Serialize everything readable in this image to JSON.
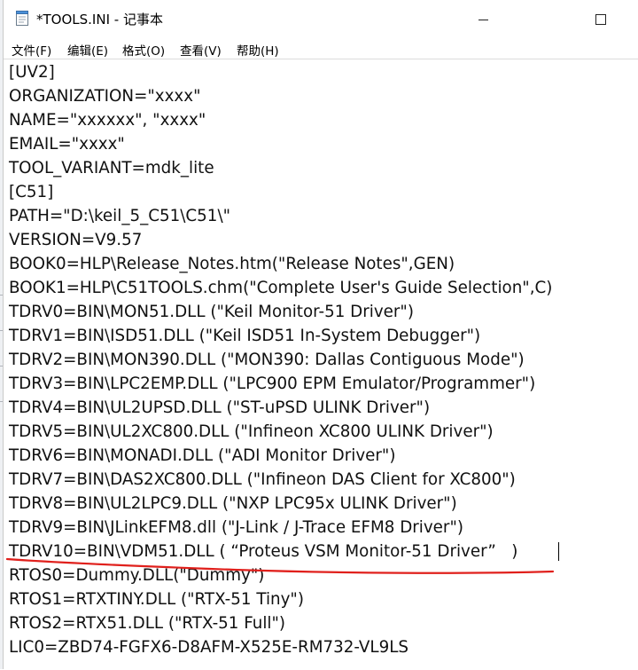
{
  "window": {
    "title": "*TOOLS.INI - 记事本",
    "icon": "notepad-icon"
  },
  "menu": [
    {
      "label": "文件(F)"
    },
    {
      "label": "编辑(E)"
    },
    {
      "label": "格式(O)"
    },
    {
      "label": "查看(V)"
    },
    {
      "label": "帮助(H)"
    }
  ],
  "editor": {
    "lines": [
      "[UV2]",
      "ORGANIZATION=\"xxxx\"",
      "NAME=\"xxxxxx\", \"xxxx\"",
      "EMAIL=\"xxxx\"",
      "TOOL_VARIANT=mdk_lite",
      "[C51]",
      "PATH=\"D:\\keil_5_C51\\C51\\\"",
      "VERSION=V9.57",
      "BOOK0=HLP\\Release_Notes.htm(\"Release Notes\",GEN)",
      "BOOK1=HLP\\C51TOOLS.chm(\"Complete User's Guide Selection\",C)",
      "TDRV0=BIN\\MON51.DLL (\"Keil Monitor-51 Driver\")",
      "TDRV1=BIN\\ISD51.DLL (\"Keil ISD51 In-System Debugger\")",
      "TDRV2=BIN\\MON390.DLL (\"MON390: Dallas Contiguous Mode\")",
      "TDRV3=BIN\\LPC2EMP.DLL (\"LPC900 EPM Emulator/Programmer\")",
      "TDRV4=BIN\\UL2UPSD.DLL (\"ST-uPSD ULINK Driver\")",
      "TDRV5=BIN\\UL2XC800.DLL (\"Infineon XC800 ULINK Driver\")",
      "TDRV6=BIN\\MONADI.DLL (\"ADI Monitor Driver\")",
      "TDRV7=BIN\\DAS2XC800.DLL (\"Infineon DAS Client for XC800\")",
      "TDRV8=BIN\\UL2LPC9.DLL (\"NXP LPC95x ULINK Driver\")",
      "TDRV9=BIN\\JLinkEFM8.dll (\"J-Link / J-Trace EFM8 Driver\")",
      "TDRV10=BIN\\VDM51.DLL ( “Proteus VSM Monitor-51 Driver”   )",
      "RTOS0=Dummy.DLL(\"Dummy\")",
      "RTOS1=RTXTINY.DLL (\"RTX-51 Tiny\")",
      "RTOS2=RTX51.DLL (\"RTX-51 Full\")",
      "LIC0=ZBD74-FGFX6-D8AFM-X525E-RM732-VL9LS"
    ]
  },
  "annotation": {
    "color": "#e0201c"
  }
}
